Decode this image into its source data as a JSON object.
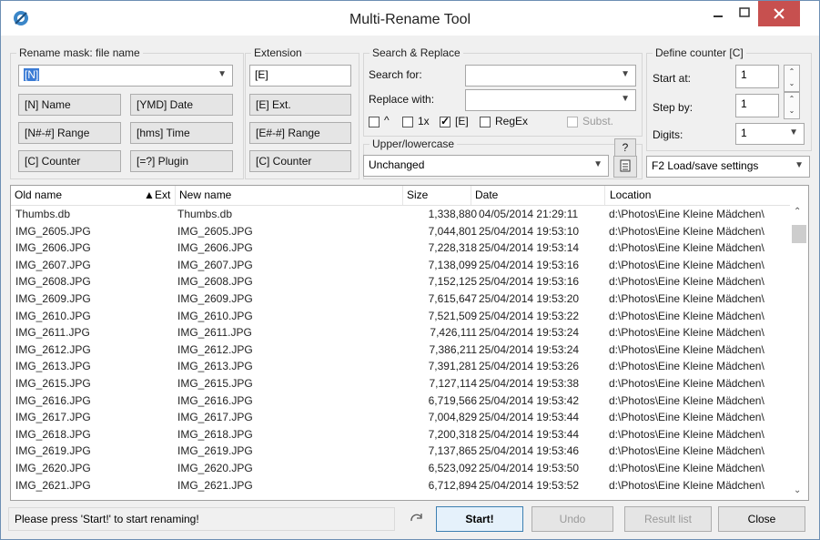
{
  "window": {
    "title": "Multi-Rename Tool"
  },
  "rename_mask": {
    "label": "Rename mask: file name",
    "value": "[N]",
    "buttons": [
      "[N] Name",
      "[YMD] Date",
      "[N#-#] Range",
      "[hms] Time",
      "[C] Counter",
      "[=?] Plugin"
    ]
  },
  "extension": {
    "label": "Extension",
    "value": "[E]",
    "buttons": [
      "[E] Ext.",
      "[E#-#] Range",
      "[C] Counter"
    ]
  },
  "search_replace": {
    "label": "Search & Replace",
    "search_label": "Search for:",
    "search_value": "",
    "replace_label": "Replace with:",
    "replace_value": "",
    "opt_caret": "^",
    "opt_1x": "1x",
    "opt_e": "[E]",
    "opt_regex": "RegEx",
    "opt_subst": "Subst."
  },
  "case": {
    "label": "Upper/lowercase",
    "help": "?",
    "value": "Unchanged"
  },
  "counter": {
    "label": "Define counter [C]",
    "start_label": "Start at:",
    "start_value": "1",
    "step_label": "Step by:",
    "step_value": "1",
    "digits_label": "Digits:",
    "digits_value": "1",
    "settings": "F2 Load/save settings"
  },
  "list": {
    "columns": {
      "old": "Old name",
      "ext": "Ext",
      "new": "New name",
      "size": "Size",
      "date": "Date",
      "location": "Location"
    },
    "rows": [
      {
        "old": "Thumbs.db",
        "new": "Thumbs.db",
        "size": "1,338,880",
        "date": "04/05/2014 21:29:11",
        "loc": "d:\\Photos\\Eine Kleine Mädchen\\"
      },
      {
        "old": "IMG_2605.JPG",
        "new": "IMG_2605.JPG",
        "size": "7,044,801",
        "date": "25/04/2014 19:53:10",
        "loc": "d:\\Photos\\Eine Kleine Mädchen\\"
      },
      {
        "old": "IMG_2606.JPG",
        "new": "IMG_2606.JPG",
        "size": "7,228,318",
        "date": "25/04/2014 19:53:14",
        "loc": "d:\\Photos\\Eine Kleine Mädchen\\"
      },
      {
        "old": "IMG_2607.JPG",
        "new": "IMG_2607.JPG",
        "size": "7,138,099",
        "date": "25/04/2014 19:53:16",
        "loc": "d:\\Photos\\Eine Kleine Mädchen\\"
      },
      {
        "old": "IMG_2608.JPG",
        "new": "IMG_2608.JPG",
        "size": "7,152,125",
        "date": "25/04/2014 19:53:16",
        "loc": "d:\\Photos\\Eine Kleine Mädchen\\"
      },
      {
        "old": "IMG_2609.JPG",
        "new": "IMG_2609.JPG",
        "size": "7,615,647",
        "date": "25/04/2014 19:53:20",
        "loc": "d:\\Photos\\Eine Kleine Mädchen\\"
      },
      {
        "old": "IMG_2610.JPG",
        "new": "IMG_2610.JPG",
        "size": "7,521,509",
        "date": "25/04/2014 19:53:22",
        "loc": "d:\\Photos\\Eine Kleine Mädchen\\"
      },
      {
        "old": "IMG_2611.JPG",
        "new": "IMG_2611.JPG",
        "size": "7,426,111",
        "date": "25/04/2014 19:53:24",
        "loc": "d:\\Photos\\Eine Kleine Mädchen\\"
      },
      {
        "old": "IMG_2612.JPG",
        "new": "IMG_2612.JPG",
        "size": "7,386,211",
        "date": "25/04/2014 19:53:24",
        "loc": "d:\\Photos\\Eine Kleine Mädchen\\"
      },
      {
        "old": "IMG_2613.JPG",
        "new": "IMG_2613.JPG",
        "size": "7,391,281",
        "date": "25/04/2014 19:53:26",
        "loc": "d:\\Photos\\Eine Kleine Mädchen\\"
      },
      {
        "old": "IMG_2615.JPG",
        "new": "IMG_2615.JPG",
        "size": "7,127,114",
        "date": "25/04/2014 19:53:38",
        "loc": "d:\\Photos\\Eine Kleine Mädchen\\"
      },
      {
        "old": "IMG_2616.JPG",
        "new": "IMG_2616.JPG",
        "size": "6,719,566",
        "date": "25/04/2014 19:53:42",
        "loc": "d:\\Photos\\Eine Kleine Mädchen\\"
      },
      {
        "old": "IMG_2617.JPG",
        "new": "IMG_2617.JPG",
        "size": "7,004,829",
        "date": "25/04/2014 19:53:44",
        "loc": "d:\\Photos\\Eine Kleine Mädchen\\"
      },
      {
        "old": "IMG_2618.JPG",
        "new": "IMG_2618.JPG",
        "size": "7,200,318",
        "date": "25/04/2014 19:53:44",
        "loc": "d:\\Photos\\Eine Kleine Mädchen\\"
      },
      {
        "old": "IMG_2619.JPG",
        "new": "IMG_2619.JPG",
        "size": "7,137,865",
        "date": "25/04/2014 19:53:46",
        "loc": "d:\\Photos\\Eine Kleine Mädchen\\"
      },
      {
        "old": "IMG_2620.JPG",
        "new": "IMG_2620.JPG",
        "size": "6,523,092",
        "date": "25/04/2014 19:53:50",
        "loc": "d:\\Photos\\Eine Kleine Mädchen\\"
      },
      {
        "old": "IMG_2621.JPG",
        "new": "IMG_2621.JPG",
        "size": "6,712,894",
        "date": "25/04/2014 19:53:52",
        "loc": "d:\\Photos\\Eine Kleine Mädchen\\"
      }
    ]
  },
  "status": {
    "message": "Please press 'Start!' to start renaming!",
    "start": "Start!",
    "undo": "Undo",
    "result_list": "Result list",
    "close": "Close"
  },
  "colors": {
    "close_button": "#c7504f",
    "window_border": "#6d8fb3",
    "panel_bg": "#f0f0f0"
  }
}
